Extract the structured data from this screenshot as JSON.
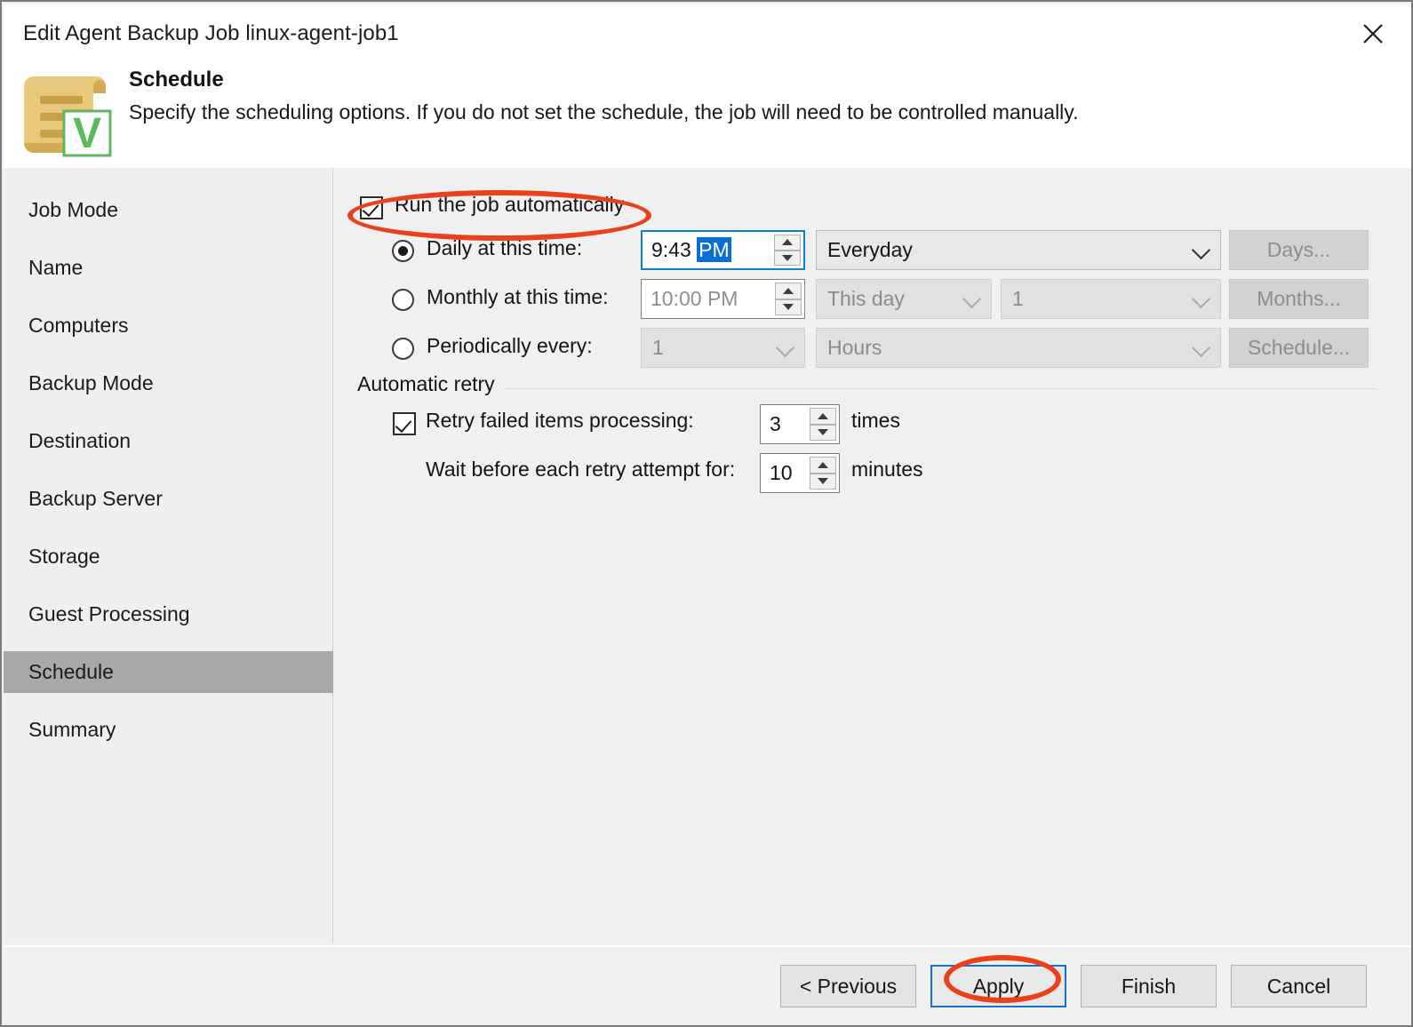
{
  "window": {
    "title": "Edit Agent Backup Job linux-agent-job1",
    "close_icon": "close-icon"
  },
  "header": {
    "icon": "schedule-document-icon",
    "title": "Schedule",
    "subtitle": "Specify the scheduling options. If you do not set the schedule, the job will need to be controlled manually."
  },
  "sidebar": {
    "items": [
      {
        "label": "Job Mode",
        "selected": false
      },
      {
        "label": "Name",
        "selected": false
      },
      {
        "label": "Computers",
        "selected": false
      },
      {
        "label": "Backup Mode",
        "selected": false
      },
      {
        "label": "Destination",
        "selected": false
      },
      {
        "label": "Backup Server",
        "selected": false
      },
      {
        "label": "Storage",
        "selected": false
      },
      {
        "label": "Guest Processing",
        "selected": false
      },
      {
        "label": "Schedule",
        "selected": true
      },
      {
        "label": "Summary",
        "selected": false
      }
    ]
  },
  "schedule": {
    "run_automatically": {
      "label": "Run the job automatically",
      "checked": true
    },
    "daily": {
      "label": "Daily at this time:",
      "selected": true,
      "time_value": "9:43 ",
      "time_selected_part": "PM",
      "frequency": "Everyday",
      "days_button": "Days..."
    },
    "monthly": {
      "label": "Monthly at this time:",
      "selected": false,
      "time_value": "10:00 PM",
      "day_kind": "This day",
      "day_number": "1",
      "months_button": "Months..."
    },
    "periodically": {
      "label": "Periodically every:",
      "selected": false,
      "interval": "1",
      "unit": "Hours",
      "schedule_button": "Schedule..."
    }
  },
  "automatic_retry": {
    "group_label": "Automatic retry",
    "retry_failed": {
      "label": "Retry failed items processing:",
      "checked": true,
      "value": "3",
      "unit": "times"
    },
    "wait_before": {
      "label": "Wait before each retry attempt for:",
      "value": "10",
      "unit": "minutes"
    }
  },
  "footer": {
    "previous": "< Previous",
    "apply": "Apply",
    "finish": "Finish",
    "cancel": "Cancel"
  },
  "annotations": {
    "accent_color": "#e8411c",
    "focus_color": "#1472d3",
    "selection_color": "#0a6ed6"
  }
}
